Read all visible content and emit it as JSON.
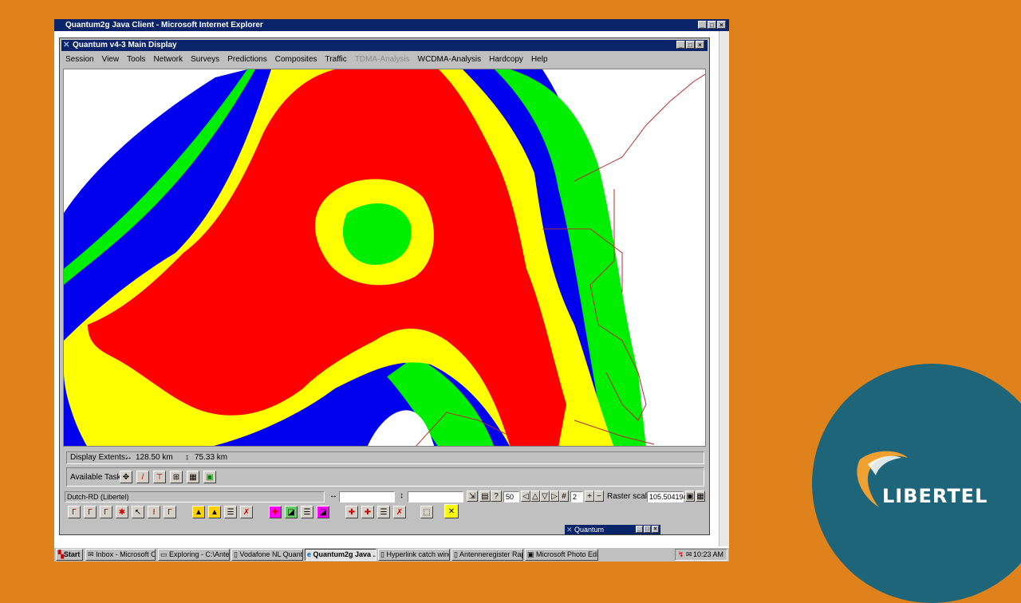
{
  "ie_window": {
    "title": "Quantum2g Java Client - Microsoft Internet Explorer"
  },
  "quantum_window": {
    "title": "Quantum v4-3  Main Display",
    "menu": [
      {
        "label": "Session",
        "enabled": true
      },
      {
        "label": "View",
        "enabled": true
      },
      {
        "label": "Tools",
        "enabled": true
      },
      {
        "label": "Network",
        "enabled": true
      },
      {
        "label": "Surveys",
        "enabled": true
      },
      {
        "label": "Predictions",
        "enabled": true
      },
      {
        "label": "Composites",
        "enabled": true
      },
      {
        "label": "Traffic",
        "enabled": true
      },
      {
        "label": "TDMA-Analysis",
        "enabled": false
      },
      {
        "label": "WCDMA-Analysis",
        "enabled": true
      },
      {
        "label": "Hardcopy",
        "enabled": true
      },
      {
        "label": "Help",
        "enabled": true
      }
    ]
  },
  "map": {
    "colors": {
      "strong": "#ff0000",
      "good": "#ffff00",
      "medium": "#00ee00",
      "weak": "#0000ee",
      "border": "#b03030"
    }
  },
  "status": {
    "display_extents_label": "Display Extents:",
    "width_value": "128.50 km",
    "height_value": "75.33 km",
    "available_tasks_label": "Available Tasks:",
    "coord_system": "Dutch-RD (Libertel)",
    "step_value": "50",
    "zoom_level": "2",
    "raster_scale_label": "Raster scale",
    "raster_scale_value": "105.504194"
  },
  "sub_window": {
    "title": "Quantum"
  },
  "taskbar": {
    "start": "Start",
    "items": [
      "Inbox - Microsoft Outl...",
      "Exploring - C:\\Antenn...",
      "Vodafone NL Quantu...",
      "Quantum2g Java ...",
      "Hyperlink catch wind...",
      "Antenneregister Rapp...",
      "Microsoft Photo Editor"
    ],
    "active_index": 3,
    "clock": "10:23 AM"
  },
  "logo": {
    "text": "LIBERTEL"
  }
}
